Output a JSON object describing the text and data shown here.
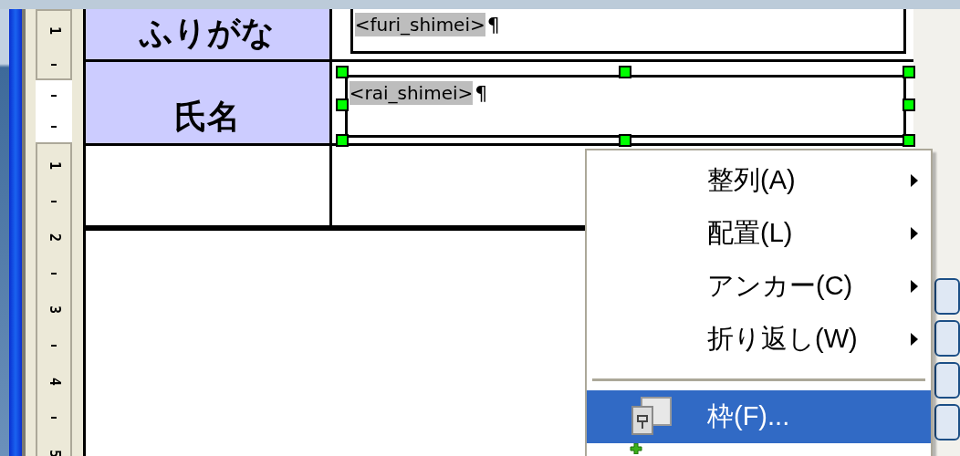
{
  "ruler": {
    "numbers": [
      "1",
      "1",
      "2",
      "3",
      "4",
      "5"
    ]
  },
  "table": {
    "rows": [
      {
        "label": "ふりがな",
        "field": "<furi_shimei>",
        "mark": "¶",
        "selected": false
      },
      {
        "label": "氏名",
        "field": "<rai_shimei>",
        "mark": "¶",
        "selected": true
      },
      {}
    ]
  },
  "context_menu": {
    "items": [
      {
        "kind": "submenu",
        "label": "整列(A)",
        "selected": false
      },
      {
        "kind": "submenu",
        "label": "配置(L)",
        "selected": false
      },
      {
        "kind": "submenu",
        "label": "アンカー(C)",
        "selected": false
      },
      {
        "kind": "submenu",
        "label": "折り返し(W)",
        "selected": false
      },
      {
        "kind": "separator"
      },
      {
        "kind": "command",
        "label": "枠(F)...",
        "selected": true
      }
    ]
  }
}
